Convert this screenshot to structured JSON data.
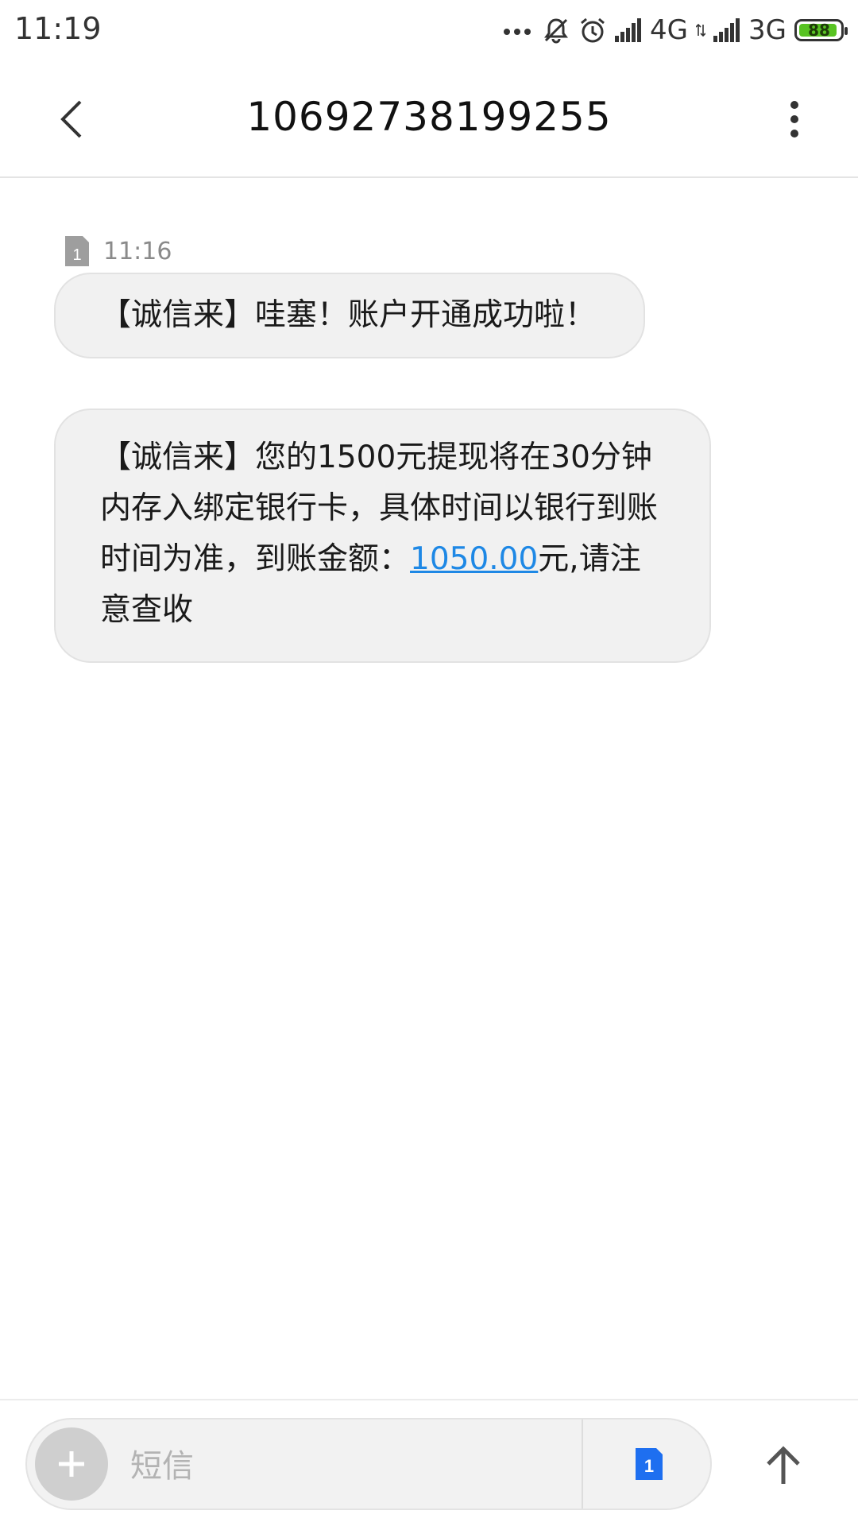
{
  "status_bar": {
    "time": "11:19",
    "network1": "4G",
    "network2": "3G",
    "battery": "88",
    "battery_color": "#58c322"
  },
  "header": {
    "title": "10692738199255",
    "back_icon": "chevron-left-icon",
    "more_icon": "more-vertical-icon"
  },
  "thread": {
    "sim_label": "1",
    "time": "11:16",
    "messages": [
      {
        "text": "【诚信来】哇塞！账户开通成功啦！"
      },
      {
        "text_before": "【诚信来】您的1500元提现将在30分钟内存入绑定银行卡，具体时间以银行到账时间为准，到账金额：",
        "link": "1050.00",
        "text_after": "元,请注意查收"
      }
    ]
  },
  "composer": {
    "placeholder": "短信",
    "sim_label": "1",
    "add_icon": "plus-icon",
    "send_icon": "arrow-up-icon",
    "accent": "#1e88e5"
  }
}
